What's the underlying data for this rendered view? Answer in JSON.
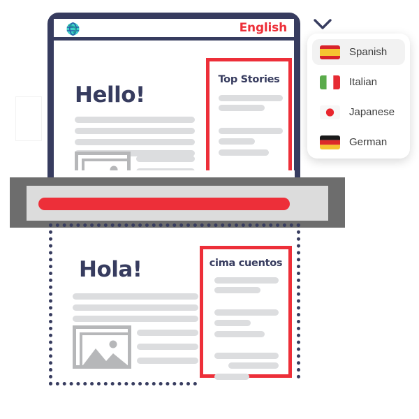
{
  "browser": {
    "globe_icon": "globe-icon",
    "current_language": "English"
  },
  "source_page": {
    "greeting": "Hello!",
    "image_placeholder_icon": "image-placeholder-icon",
    "stories": {
      "title": "Top Stories"
    }
  },
  "translated_page": {
    "greeting": "Hola!",
    "image_placeholder_icon": "image-placeholder-icon",
    "stories": {
      "title": "cima cuentos"
    }
  },
  "dropdown": {
    "chevron_icon": "chevron-down-icon",
    "options": [
      {
        "label": "Spanish",
        "flag": "flag-spain",
        "selected": true
      },
      {
        "label": "Italian",
        "flag": "flag-italy",
        "selected": false
      },
      {
        "label": "Japanese",
        "flag": "flag-japan",
        "selected": false
      },
      {
        "label": "German",
        "flag": "flag-germany",
        "selected": false
      }
    ]
  },
  "scanner": {
    "scan_bar_color": "#ed2f39"
  },
  "colors": {
    "navy": "#373c5f",
    "red": "#ed2f39",
    "skeleton": "#dcdddf",
    "scanner_frame": "#6d6d6d",
    "scanner_inner": "#dcdcdc",
    "placeholder_gray": "#b6b7b9"
  }
}
